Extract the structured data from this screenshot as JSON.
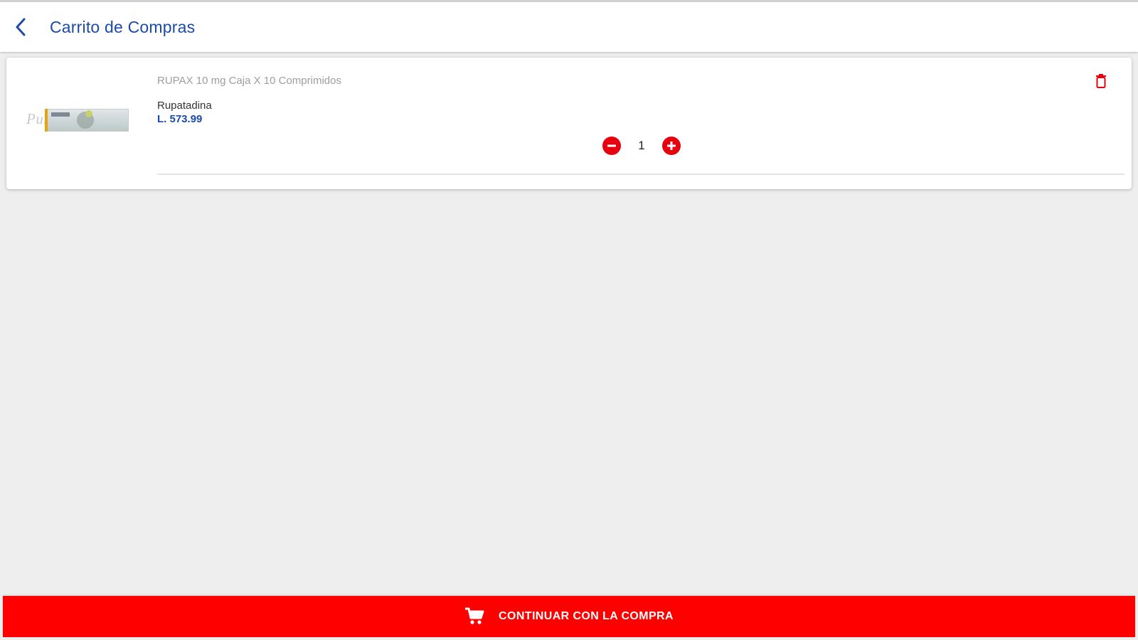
{
  "header": {
    "back_icon": "chevron-left-icon",
    "title": "Carrito de Compras"
  },
  "cart": {
    "items": [
      {
        "name": "RUPAX 10 mg Caja X 10 Comprimidos",
        "generic": "Rupatadina",
        "price": "L. 573.99",
        "quantity": "1",
        "image_watermark": "Punto Farma",
        "delete_icon": "trash-icon",
        "decrement_icon": "minus-circle-icon",
        "increment_icon": "plus-circle-icon"
      }
    ]
  },
  "footer": {
    "continue_label": "CONTINUAR CON LA COMPRA",
    "cart_icon": "cart-icon"
  },
  "colors": {
    "primary_blue": "#1b4aa8",
    "accent_red": "#ff0000",
    "background": "#eeeeee"
  }
}
